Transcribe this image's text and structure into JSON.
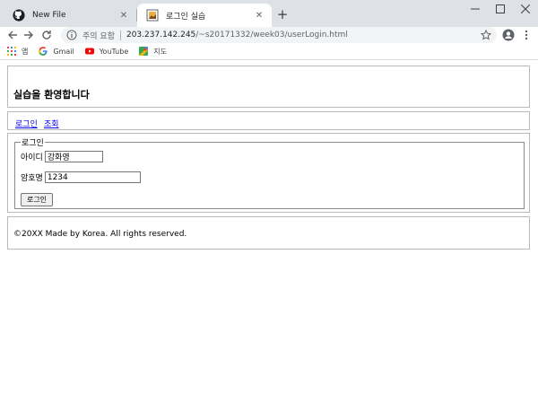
{
  "browser": {
    "tabs": [
      {
        "title": "New File",
        "icon": "github-icon"
      },
      {
        "title": "로그인 실습",
        "icon": "page-favicon"
      }
    ],
    "omnibox": {
      "security_label": "주의 요함",
      "url_host": "203.237.142.245",
      "url_path": "/~s20171332/week03/userLogin.html"
    },
    "bookmarks": [
      {
        "label": "앱",
        "icon": "apps-grid-icon"
      },
      {
        "label": "Gmail",
        "icon": "google-icon"
      },
      {
        "label": "YouTube",
        "icon": "youtube-icon"
      },
      {
        "label": "지도",
        "icon": "maps-icon"
      }
    ],
    "colors": {
      "tabstrip": "#dee1e6",
      "omnibox": "#f1f3f4",
      "link": "#0000ee"
    }
  },
  "page": {
    "heading": "실습을 환영합니다",
    "nav": {
      "login": "로그인",
      "view": "조회"
    },
    "form": {
      "legend": "로그인",
      "id_label": "아이디",
      "id_value": "강화영",
      "pw_label": "암호명",
      "pw_value": "1234",
      "submit": "로그인"
    },
    "footer": "©20XX Made by Korea. All rights reserved."
  }
}
